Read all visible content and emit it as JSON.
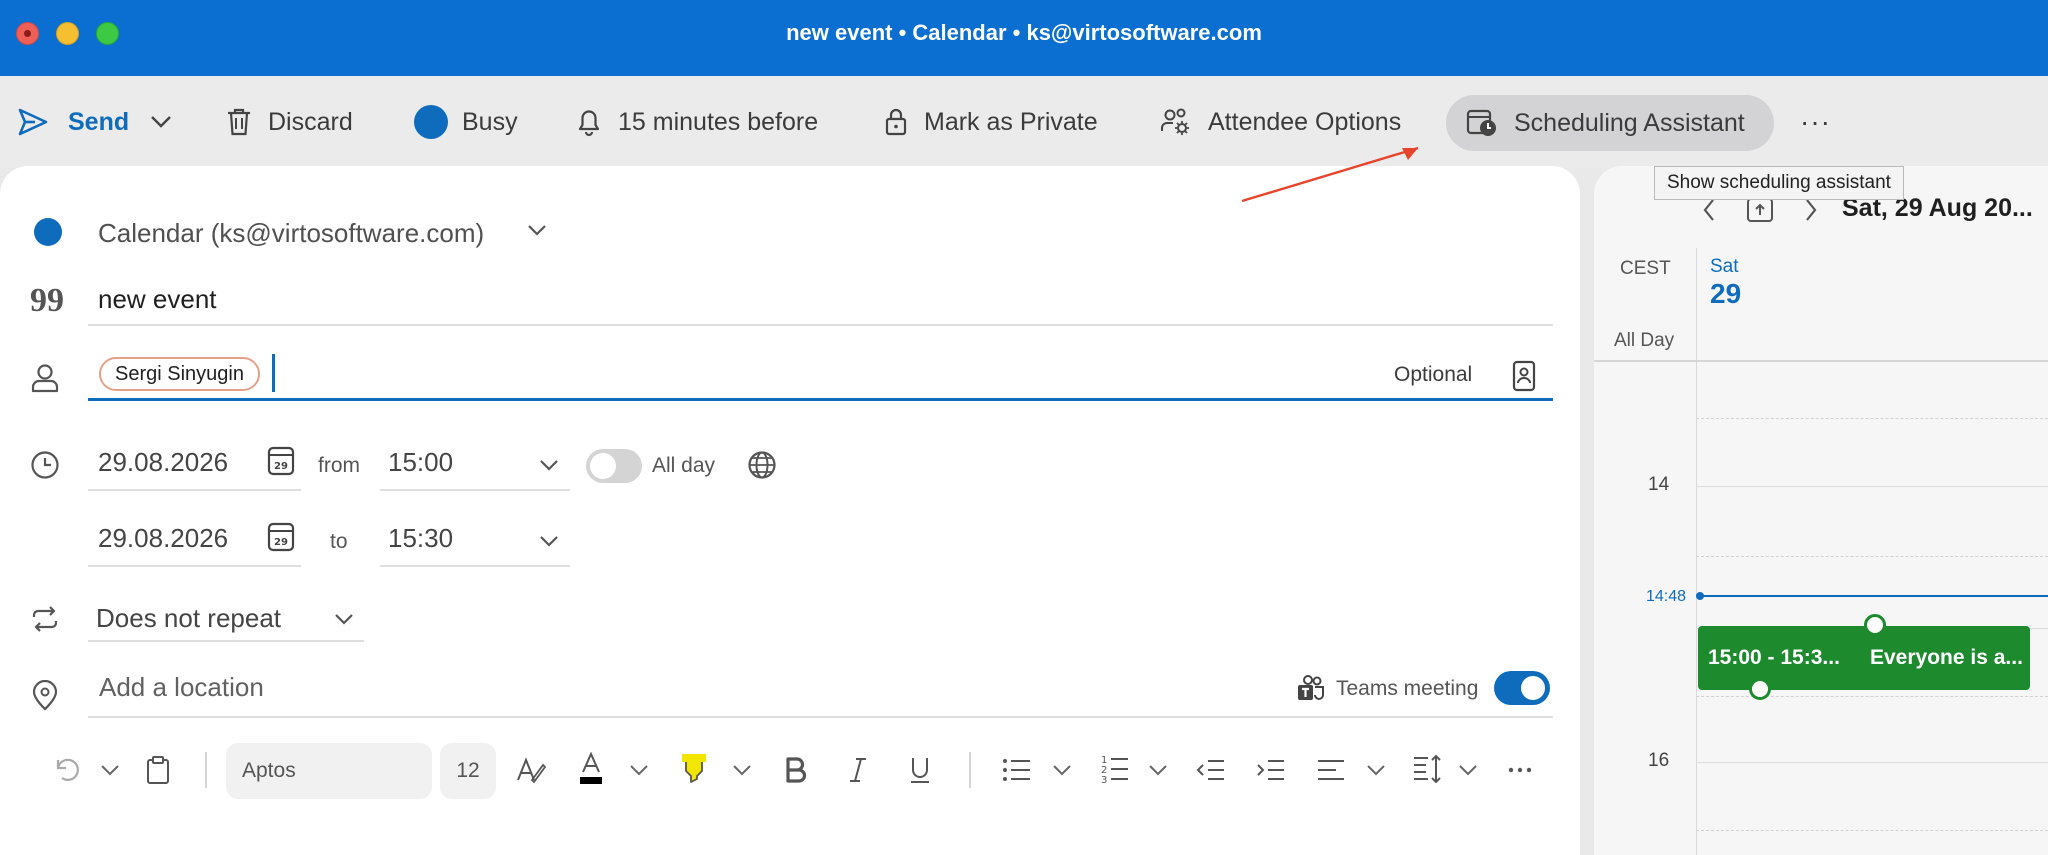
{
  "window": {
    "title": "new event • Calendar • ks@virtosoftware.com"
  },
  "toolbar": {
    "send_label": "Send",
    "discard_label": "Discard",
    "busy_label": "Busy",
    "reminder_label": "15 minutes before",
    "private_label": "Mark as Private",
    "attendee_label": "Attendee Options",
    "scheduling_label": "Scheduling Assistant",
    "more_label": "···",
    "tooltip": "Show scheduling assistant"
  },
  "form": {
    "calendar_name": "Calendar (ks@virtosoftware.com)",
    "title": "new event",
    "attendee_chip": "Sergi Sinyugin",
    "optional_label": "Optional",
    "start_date": "29.08.2026",
    "start_time": "15:00",
    "from_label": "from",
    "end_date": "29.08.2026",
    "end_time": "15:30",
    "to_label": "to",
    "all_day_label": "All day",
    "all_day_on": false,
    "repeat": "Does not repeat",
    "location_placeholder": "Add a location",
    "teams_label": "Teams meeting",
    "teams_on": true,
    "calendar_icon_day": "29"
  },
  "format_bar": {
    "font": "Aptos",
    "size": "12"
  },
  "side_calendar": {
    "date_title": "Sat, 29 Aug 20...",
    "timezone": "CEST",
    "all_day": "All Day",
    "day_name": "Sat",
    "day_number": "29",
    "hours": [
      "14",
      "16"
    ],
    "now_time": "14:48",
    "event_time": "15:00 - 15:3...",
    "event_title": "Everyone is a..."
  },
  "colors": {
    "title_bar": "#0a6fd1",
    "accent": "#0f6cbd",
    "event": "#1d8a2e",
    "arrow": "#e8442c"
  }
}
